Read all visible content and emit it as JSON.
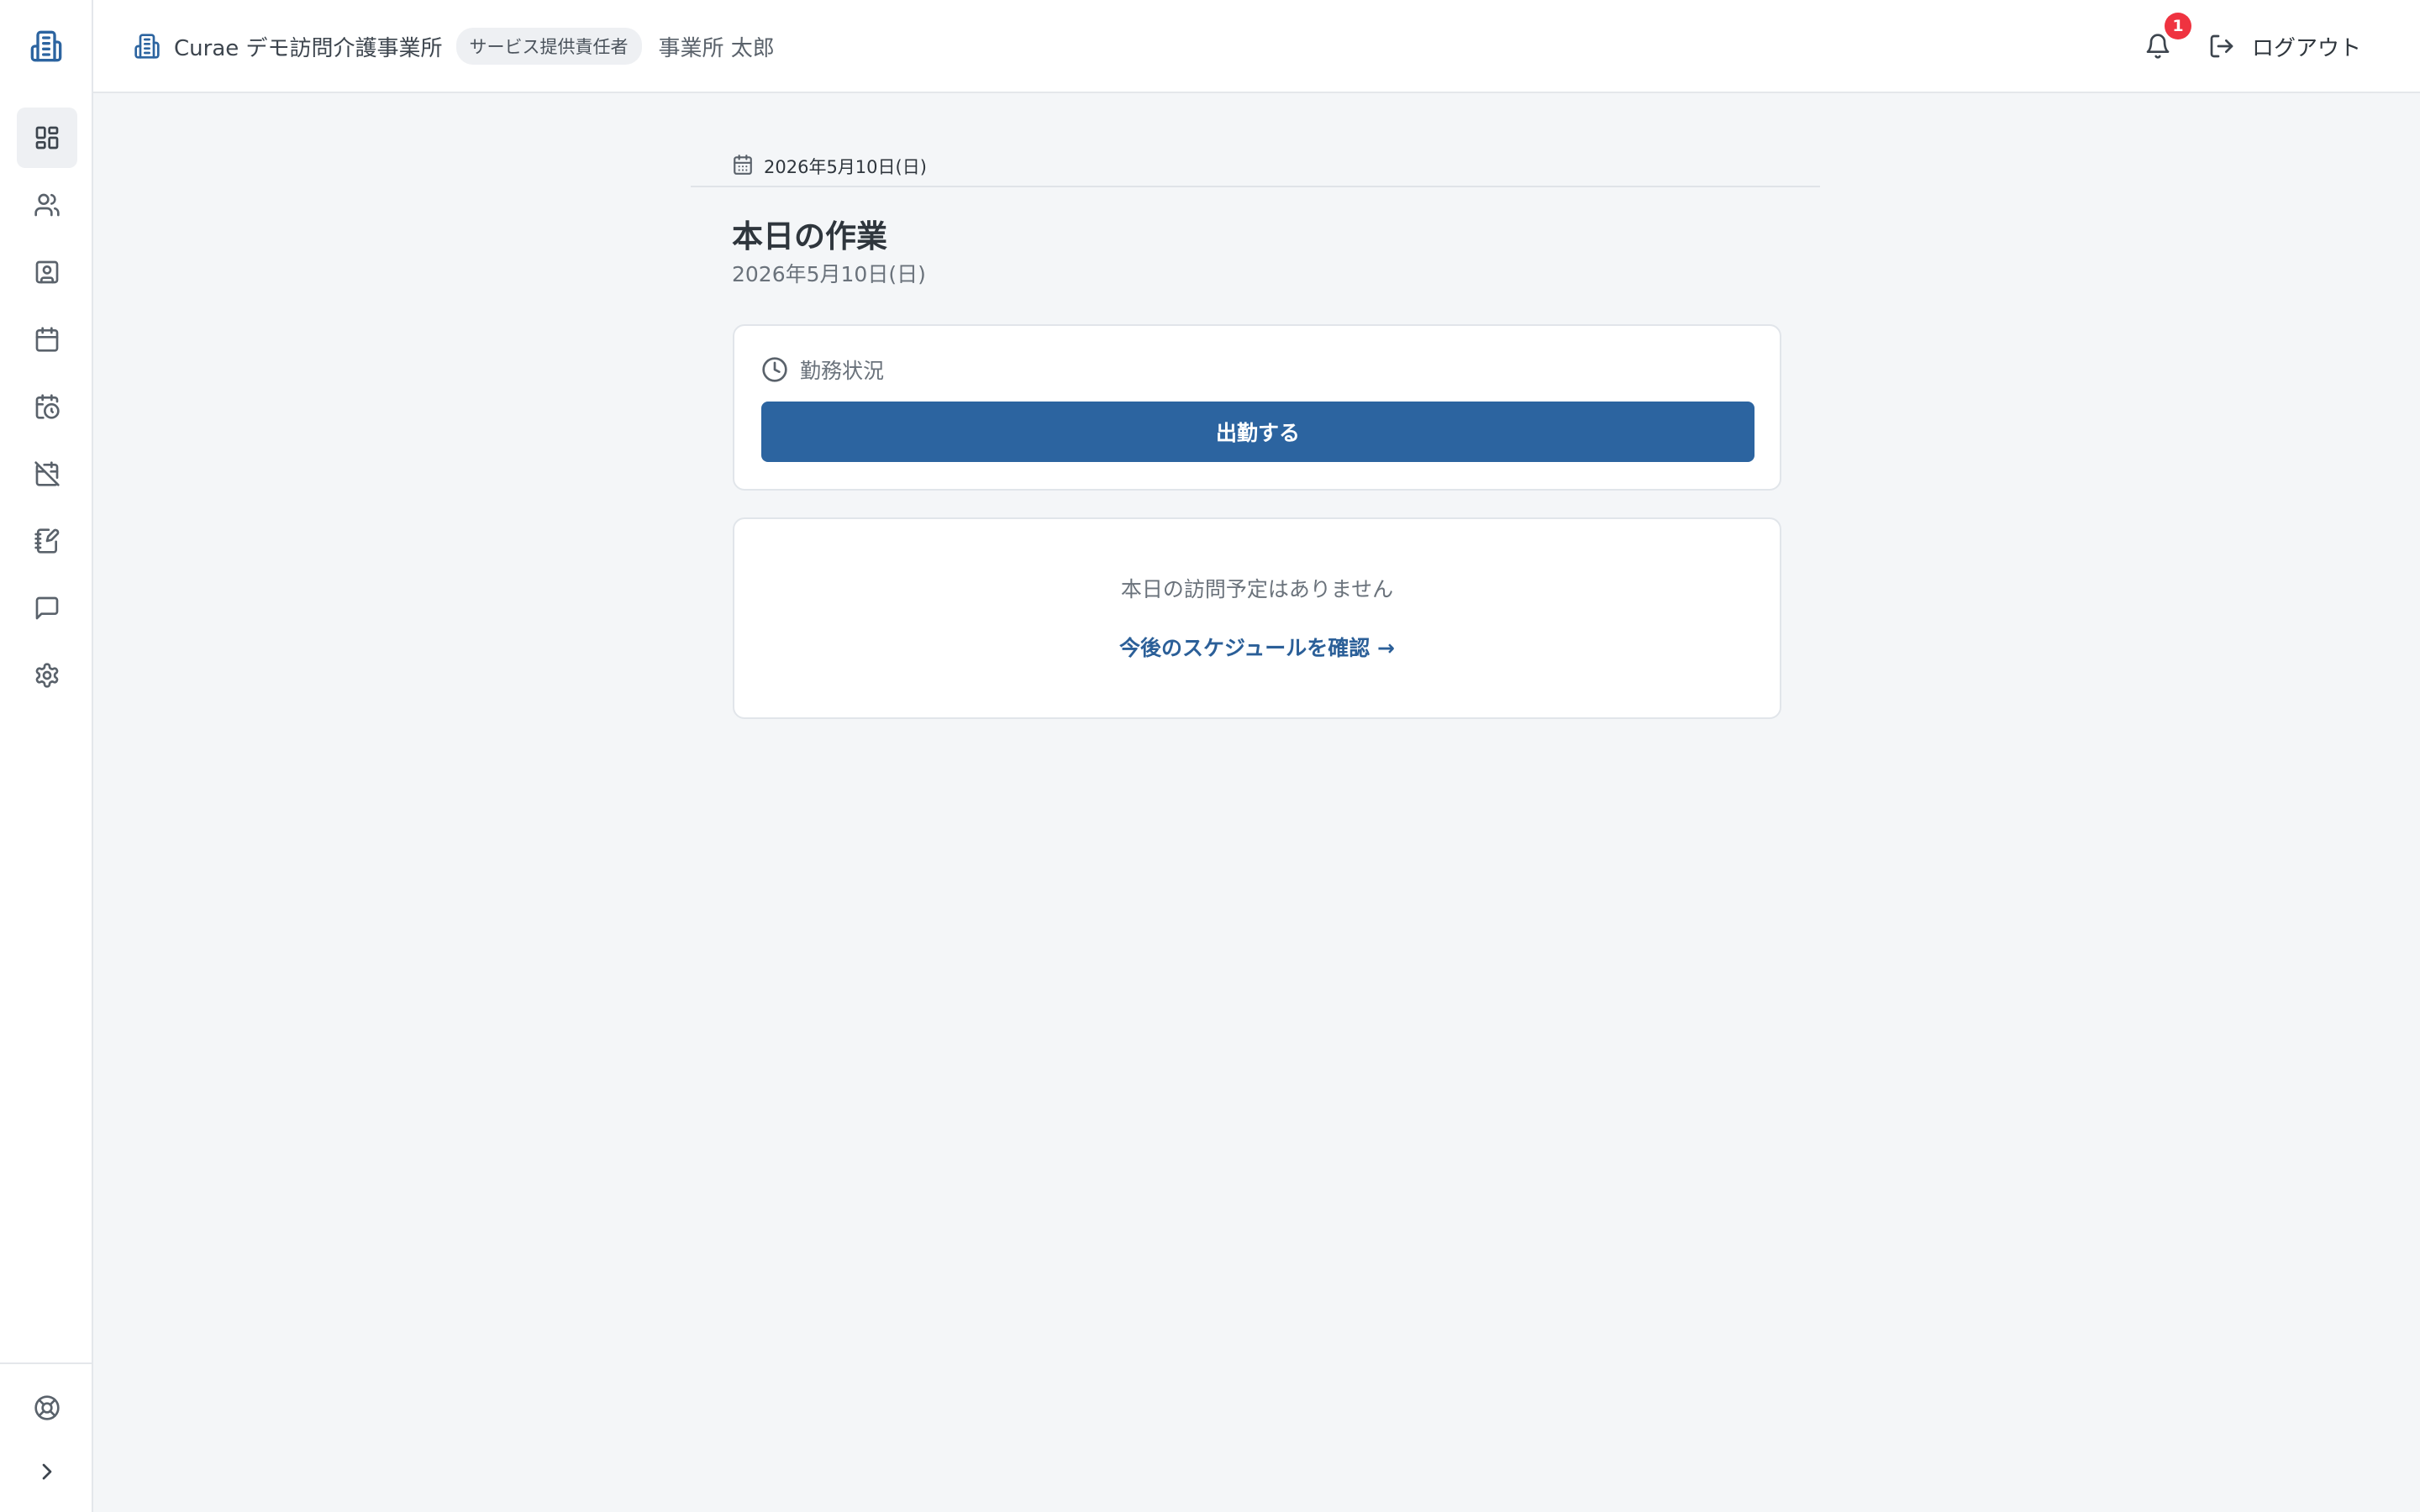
{
  "header": {
    "office_name": "Curae デモ訪問介護事業所",
    "role_badge": "サービス提供責任者",
    "user_name": "事業所 太郎",
    "notification_count": "1",
    "logout_label": "ログアウト"
  },
  "sidebar": {
    "items": [
      {
        "name": "dashboard",
        "icon": "dashboard-icon",
        "active": true
      },
      {
        "name": "users",
        "icon": "users-icon"
      },
      {
        "name": "contacts",
        "icon": "contact-card-icon"
      },
      {
        "name": "calendar",
        "icon": "calendar-icon"
      },
      {
        "name": "schedule",
        "icon": "calendar-clock-icon"
      },
      {
        "name": "calendar-off",
        "icon": "calendar-off-icon"
      },
      {
        "name": "records",
        "icon": "notebook-pen-icon"
      },
      {
        "name": "messages",
        "icon": "message-icon"
      },
      {
        "name": "settings",
        "icon": "gear-icon"
      }
    ],
    "bottom": [
      {
        "name": "help",
        "icon": "life-buoy-icon"
      },
      {
        "name": "expand",
        "icon": "chevron-right-icon"
      }
    ]
  },
  "main": {
    "date_bar": "2026年5月10日(日)",
    "title": "本日の作業",
    "subtitle": "2026年5月10日(日)",
    "attendance": {
      "heading": "勤務状況",
      "checkin_label": "出勤する"
    },
    "schedule": {
      "empty_text": "本日の訪問予定はありません",
      "link_label": "今後のスケジュールを確認 →"
    }
  },
  "colors": {
    "primary": "#2c64a0",
    "link": "#2b5f98",
    "badge": "#ef3340",
    "background": "#f4f6f8"
  }
}
